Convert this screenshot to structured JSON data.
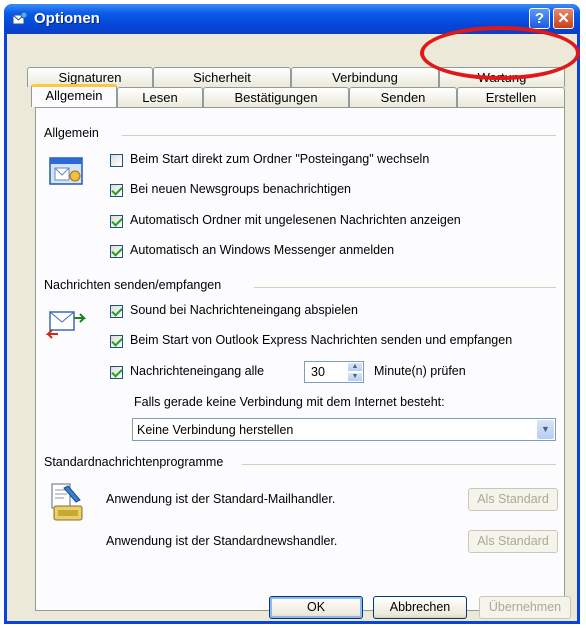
{
  "window": {
    "title": "Optionen",
    "help_glyph": "?",
    "close_glyph": "✕"
  },
  "tabs_back": [
    {
      "label": "Signaturen"
    },
    {
      "label": "Sicherheit"
    },
    {
      "label": "Verbindung"
    },
    {
      "label": "Wartung"
    }
  ],
  "tabs_front": [
    {
      "label": "Allgemein",
      "active": true
    },
    {
      "label": "Lesen"
    },
    {
      "label": "Bestätigungen"
    },
    {
      "label": "Senden"
    },
    {
      "label": "Erstellen"
    }
  ],
  "groups": {
    "general": {
      "label": "Allgemein",
      "options": [
        {
          "label": "Beim Start direkt zum Ordner \"Posteingang\" wechseln",
          "checked": false
        },
        {
          "label": "Bei neuen Newsgroups benachrichtigen",
          "checked": true
        },
        {
          "label": "Automatisch Ordner mit ungelesenen Nachrichten anzeigen",
          "checked": true
        },
        {
          "label": "Automatisch an Windows Messenger anmelden",
          "checked": true
        }
      ]
    },
    "send_receive": {
      "label": "Nachrichten senden/empfangen",
      "options": [
        {
          "label": "Sound bei Nachrichteneingang abspielen",
          "checked": true
        },
        {
          "label": "Beim Start von Outlook Express Nachrichten senden und empfangen",
          "checked": true
        },
        {
          "label": "Nachrichteneingang alle",
          "checked": true
        }
      ],
      "interval_value": "30",
      "interval_suffix": "Minute(n) prüfen",
      "no_connection_label": "Falls gerade keine Verbindung mit dem Internet besteht:",
      "no_connection_selected": "Keine Verbindung herstellen"
    },
    "default_programs": {
      "label": "Standardnachrichtenprogramme",
      "mail_text": "Anwendung ist der Standard-Mailhandler.",
      "news_text": "Anwendung ist der Standardnewshandler.",
      "set_default_label": "Als Standard"
    }
  },
  "footer": {
    "ok": "OK",
    "cancel": "Abbrechen",
    "apply": "Übernehmen"
  },
  "colors": {
    "title_bar": "#0a5ce8",
    "dialog_bg": "#ece9d8",
    "annotation": "#e01818",
    "active_tab_accent": "#ffc83c"
  }
}
